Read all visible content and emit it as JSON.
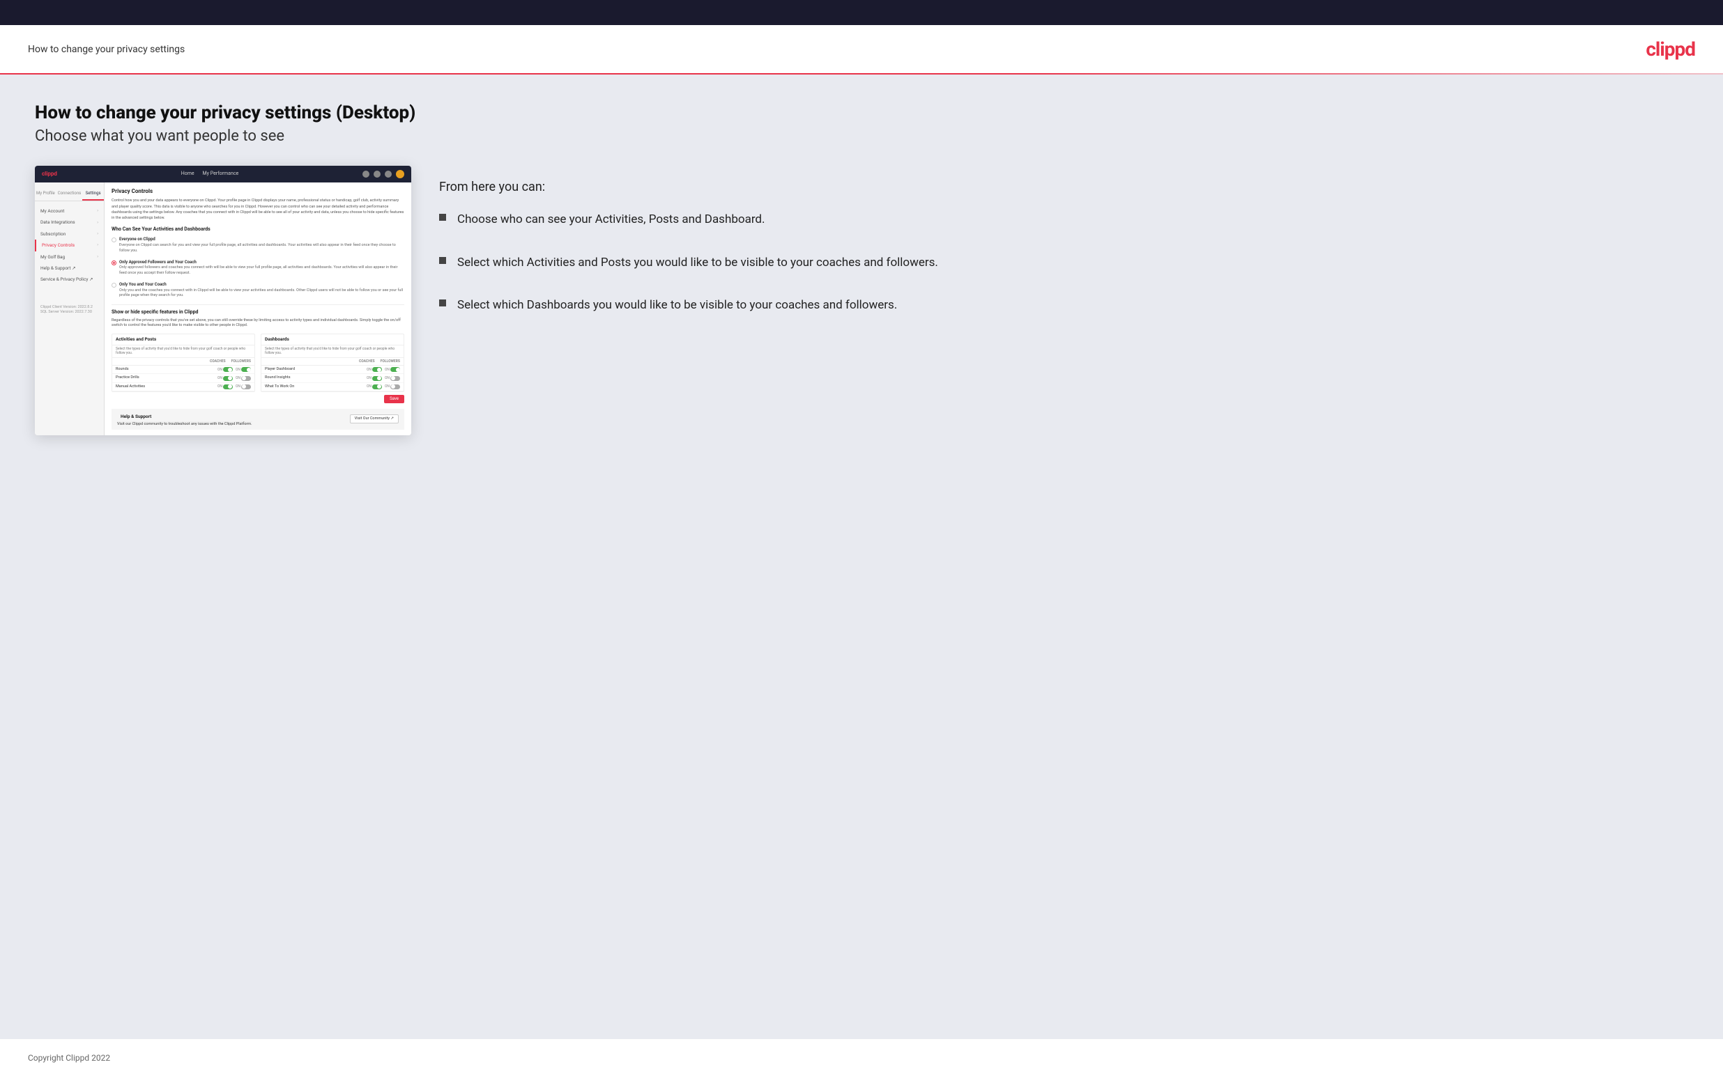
{
  "topBar": {},
  "header": {
    "title": "How to change your privacy settings",
    "logo": "clippd"
  },
  "page": {
    "heading": "How to change your privacy settings (Desktop)",
    "subheading": "Choose what you want people to see"
  },
  "sidebar": {
    "tabs": [
      "My Profile",
      "Connections",
      "Settings"
    ],
    "activeTab": "Settings",
    "items": [
      {
        "label": "My Account",
        "active": false
      },
      {
        "label": "Data Integrations",
        "active": false
      },
      {
        "label": "Subscription",
        "active": false
      },
      {
        "label": "Privacy Controls",
        "active": true
      },
      {
        "label": "My Golf Bag",
        "active": false
      },
      {
        "label": "Help & Support",
        "active": false
      },
      {
        "label": "Service & Privacy Policy",
        "active": false
      }
    ],
    "footer": {
      "line1": "Clippd Client Version: 2022.8.2",
      "line2": "SQL Server Version: 2022.7.30"
    }
  },
  "miniApp": {
    "nav": {
      "logo": "clippd",
      "links": [
        "Home",
        "My Performance"
      ]
    },
    "privacyControls": {
      "title": "Privacy Controls",
      "description": "Control how you and your data appears to everyone on Clippd. Your profile page in Clippd displays your name, professional status or handicap, golf club, activity summary and player quality score. This data is visible to anyone who searches for you in Clippd. However you can control who can see your detailed activity and performance dashboards using the settings below. Any coaches that you connect with in Clippd will be able to see all of your activity and data, unless you choose to hide specific features in the advanced settings below."
    },
    "whoCanSee": {
      "title": "Who Can See Your Activities and Dashboards",
      "options": [
        {
          "id": "everyone",
          "title": "Everyone on Clippd",
          "description": "Everyone on Clippd can search for you and view your full profile page, all activities and dashboards. Your activities will also appear in their feed once they choose to follow you.",
          "selected": false
        },
        {
          "id": "followers",
          "title": "Only Approved Followers and Your Coach",
          "description": "Only approved followers and coaches you connect with will be able to view your full profile page, all activities and dashboards. Your activities will also appear in their feed once you accept their follow request.",
          "selected": true
        },
        {
          "id": "coach",
          "title": "Only You and Your Coach",
          "description": "Only you and the coaches you connect with in Clippd will be able to view your activities and dashboards. Other Clippd users will not be able to follow you or see your full profile page when they search for you.",
          "selected": false
        }
      ]
    },
    "showHide": {
      "title": "Show or hide specific features in Clippd",
      "description": "Regardless of the privacy controls that you've set above, you can still override these by limiting access to activity types and individual dashboards. Simply toggle the on/off switch to control the features you'd like to make visible to other people in Clippd.",
      "activitiesAndPosts": {
        "title": "Activities and Posts",
        "description": "Select the types of activity that you'd like to hide from your golf coach or people who follow you.",
        "columns": [
          "COACHES",
          "FOLLOWERS"
        ],
        "rows": [
          {
            "label": "Rounds",
            "coaches": true,
            "followers": true
          },
          {
            "label": "Practice Drills",
            "coaches": true,
            "followers": false
          },
          {
            "label": "Manual Activities",
            "coaches": true,
            "followers": false
          }
        ]
      },
      "dashboards": {
        "title": "Dashboards",
        "description": "Select the types of activity that you'd like to hide from your golf coach or people who follow you.",
        "columns": [
          "COACHES",
          "FOLLOWERS"
        ],
        "rows": [
          {
            "label": "Player Dashboard",
            "coaches": true,
            "followers": true
          },
          {
            "label": "Round Insights",
            "coaches": true,
            "followers": false
          },
          {
            "label": "What To Work On",
            "coaches": true,
            "followers": false
          }
        ]
      }
    },
    "saveButton": "Save",
    "help": {
      "title": "Help & Support",
      "description": "Visit our Clippd community to troubleshoot any issues with the Clippd Platform.",
      "button": "Visit Our Community"
    }
  },
  "bullets": {
    "heading": "From here you can:",
    "items": [
      "Choose who can see your Activities, Posts and Dashboard.",
      "Select which Activities and Posts you would like to be visible to your coaches and followers.",
      "Select which Dashboards you would like to be visible to your coaches and followers."
    ]
  },
  "footer": {
    "copyright": "Copyright Clippd 2022"
  }
}
